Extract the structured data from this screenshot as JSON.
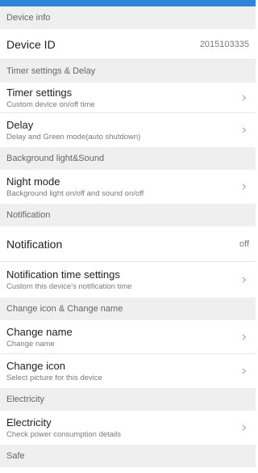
{
  "sections": {
    "device_info": "Device info",
    "timer_delay": "Timer settings & Delay",
    "background": "Background light&Sound",
    "notification": "Notification",
    "change": "Change icon & Change name",
    "electricity": "Electricity",
    "safe": "Safe"
  },
  "device_id": {
    "label": "Device ID",
    "value": "2015103335"
  },
  "timer_settings": {
    "title": "Timer settings",
    "subtitle": "Custom device on/off time"
  },
  "delay": {
    "title": "Delay",
    "subtitle": "Delay and Green mode(auto shutdown)"
  },
  "night_mode": {
    "title": "Night mode",
    "subtitle": "Background light on/off and sound on/off"
  },
  "notification": {
    "title": "Notification",
    "value": "off"
  },
  "notification_time": {
    "title": "Notification time settings",
    "subtitle": "Custom this device's notification time"
  },
  "change_name": {
    "title": "Change name",
    "subtitle": "Change name"
  },
  "change_icon": {
    "title": "Change icon",
    "subtitle": "Select picture for this device"
  },
  "electricity": {
    "title": "Electricity",
    "subtitle": "Check power consumption details"
  },
  "icons": {
    "chevron": "chevron-right-icon"
  },
  "colors": {
    "accent": "#2f86d9",
    "section_bg": "#efefef"
  }
}
